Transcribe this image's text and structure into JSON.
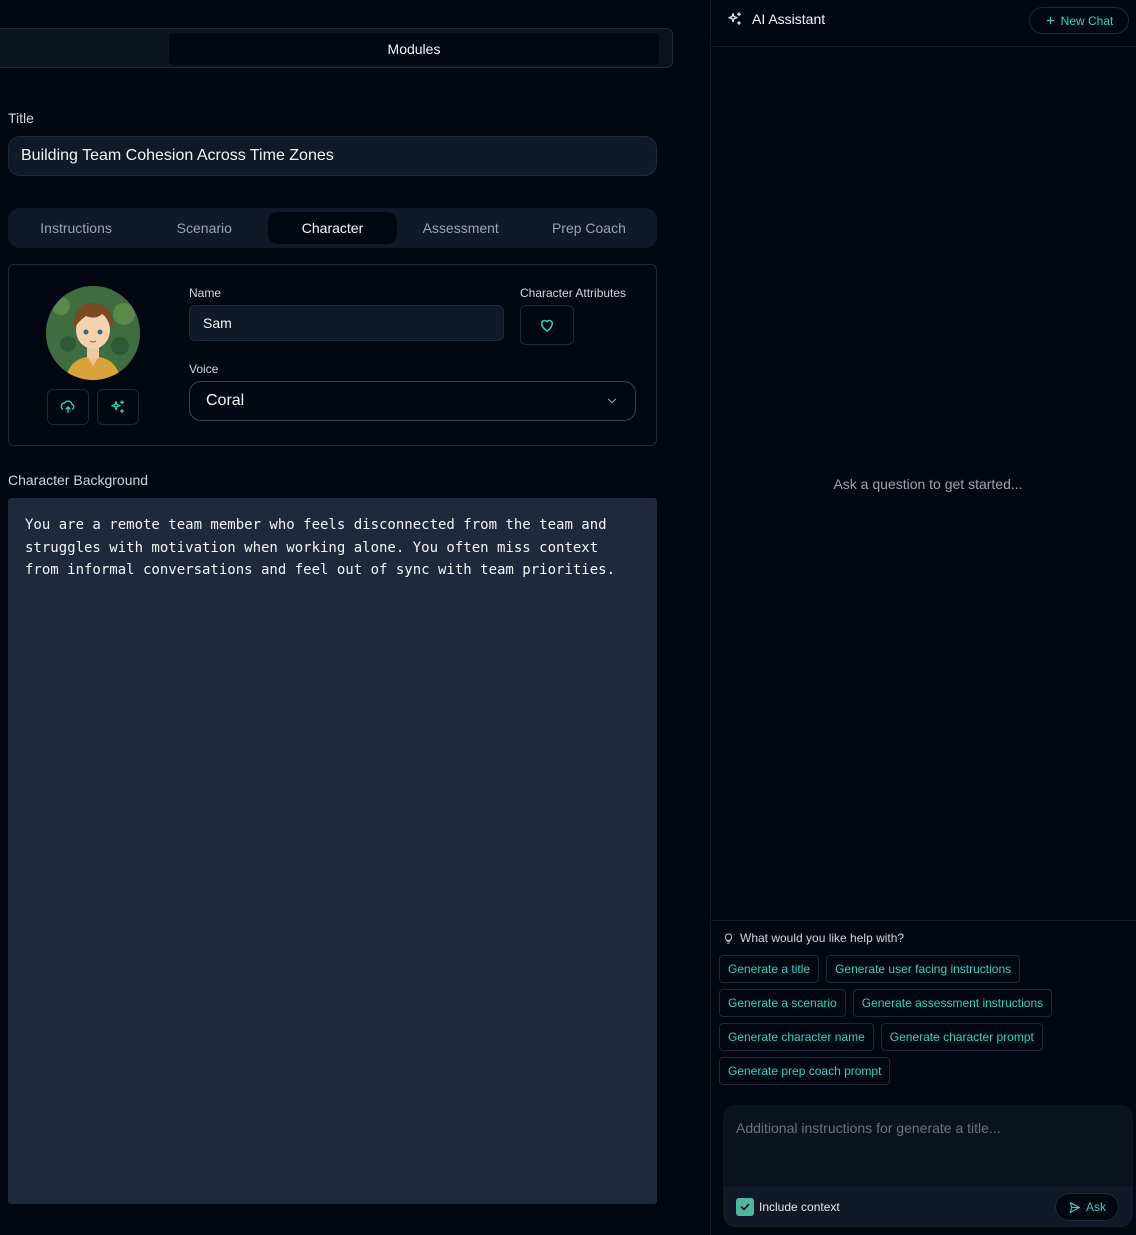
{
  "modules": {
    "tab_label": "Modules"
  },
  "form": {
    "title_label": "Title",
    "title_value": "Building Team Cohesion Across Time Zones",
    "tabs": [
      {
        "label": "Instructions"
      },
      {
        "label": "Scenario"
      },
      {
        "label": "Character"
      },
      {
        "label": "Assessment"
      },
      {
        "label": "Prep Coach"
      }
    ],
    "active_tab": "Character",
    "character": {
      "name_label": "Name",
      "name_value": "Sam",
      "attributes_label": "Character Attributes",
      "voice_label": "Voice",
      "voice_value": "Coral",
      "background_label": "Character Background",
      "background_text": "You are a remote team member who feels disconnected from the team and\nstruggles with motivation when working alone. You often miss context\nfrom informal conversations and feel out of sync with team priorities."
    }
  },
  "assistant": {
    "title": "AI Assistant",
    "new_chat_label": "New Chat",
    "empty_message": "Ask a question to get started...",
    "help_question": "What would you like help with?",
    "suggestions": [
      {
        "label": "Generate a title"
      },
      {
        "label": "Generate user facing instructions"
      },
      {
        "label": "Generate a scenario"
      },
      {
        "label": "Generate assessment instructions"
      },
      {
        "label": "Generate character name"
      },
      {
        "label": "Generate character prompt"
      },
      {
        "label": "Generate prep coach prompt"
      }
    ],
    "composer_placeholder": "Additional instructions for generate a title...",
    "include_context_label": "Include context",
    "include_context_checked": true,
    "ask_label": "Ask"
  },
  "colors": {
    "accent": "#2dd4bf",
    "background": "#030712",
    "checkbox": "#4fb59e"
  }
}
